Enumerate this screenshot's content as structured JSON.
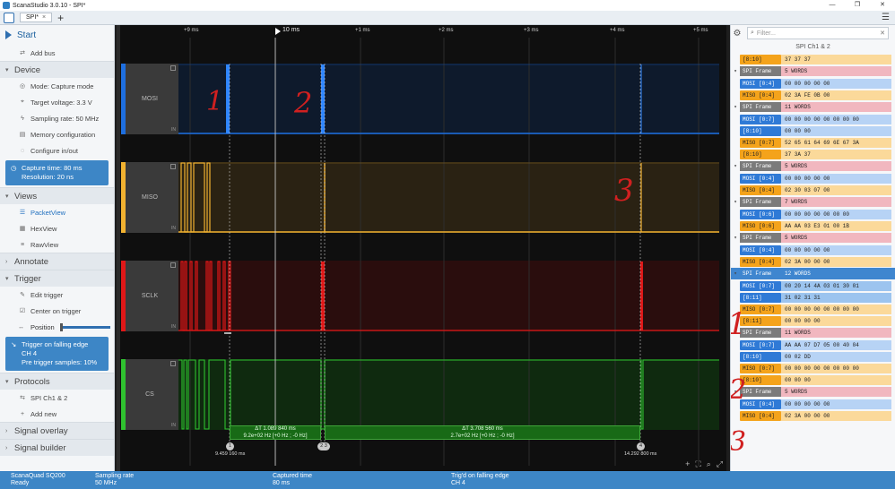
{
  "window": {
    "title": "ScanaStudio 3.0.10 - SPI*",
    "buttons": [
      "—",
      "❐",
      "✕"
    ]
  },
  "tabs": [
    {
      "label": "SPI*"
    }
  ],
  "sidebar": {
    "start": "Start",
    "add_bus": "Add bus",
    "device": {
      "title": "Device",
      "items": [
        "Mode: Capture mode",
        "Target voltage: 3.3 V",
        "Sampling rate: 50 MHz",
        "Memory configuration",
        "Configure in/out"
      ],
      "capture_box": [
        "Capture time: 80 ms",
        "Resolution: 20 ns"
      ]
    },
    "views": {
      "title": "Views",
      "items": [
        "PacketView",
        "HexView",
        "RawView"
      ]
    },
    "annotate": "Annotate",
    "trigger": {
      "title": "Trigger",
      "items": [
        "Edit trigger",
        "Center on trigger",
        "Position"
      ],
      "box": [
        "Trigger on falling edge",
        "CH 4",
        "Pre trigger samples: 10%"
      ]
    },
    "protocols": {
      "title": "Protocols",
      "items": [
        "SPI Ch1 & 2",
        "Add new"
      ]
    },
    "signal_overlay": "Signal overlay",
    "signal_builder": "Signal builder"
  },
  "waveform": {
    "cursor_label": "10 ms",
    "time_labels": [
      "+9 ms",
      "+1 ms",
      "+2 ms",
      "+3 ms",
      "+4 ms",
      "+5 ms"
    ],
    "channels": [
      {
        "name": "MOSI",
        "color": "#1e6fe0"
      },
      {
        "name": "MISO",
        "color": "#f2b230"
      },
      {
        "name": "SCLK",
        "color": "#e01818"
      },
      {
        "name": "CS",
        "color": "#2fc22f"
      }
    ],
    "measure1": {
      "delta": "ΔT 1.089 840 ms",
      "freq": "9.2e+02 Hz [+0 Hz ; -0 Hz]"
    },
    "measure2": {
      "delta": "ΔT 3.708 560 ms",
      "freq": "2.7e+02 Hz [+0 Hz ; -0 Hz]"
    },
    "markers": [
      "1",
      "2 3",
      "4"
    ],
    "marker_times": [
      "9.459 160 ms",
      "14.292 800 ms"
    ],
    "annotations": [
      "1",
      "2",
      "3"
    ],
    "bottom_icons": [
      "+",
      "⛶",
      "⌕",
      "⤢"
    ]
  },
  "packets": {
    "filter_placeholder": "Filter...",
    "header": "SPI Ch1 & 2",
    "first_row": {
      "name": "[8:10]",
      "value": "37 37 37"
    },
    "frames": [
      {
        "name": "SPI Frame",
        "words": "5 WORDS",
        "rows": [
          {
            "type": "mosi",
            "name": "MOSI [0:4]",
            "value": "00 00 00 00 00"
          },
          {
            "type": "miso",
            "name": "MISO [0:4]",
            "value": "02 3A FE 0B 00"
          }
        ]
      },
      {
        "name": "SPI Frame",
        "words": "11 WORDS",
        "rows": [
          {
            "type": "mosi",
            "name": "MOSI [0:7]",
            "value": "00 00 00 00 00 00 00 00"
          },
          {
            "type": "mosi",
            "name": "[8:10]",
            "value": "00 00 00"
          },
          {
            "type": "miso",
            "name": "MISO [0:7]",
            "value": "52 65 61 64 69 6E 67 3A"
          },
          {
            "type": "miso",
            "name": "[8:10]",
            "value": "37 3A 37"
          }
        ]
      },
      {
        "name": "SPI Frame",
        "words": "5 WORDS",
        "rows": [
          {
            "type": "mosi",
            "name": "MOSI [0:4]",
            "value": "00 00 00 00 00"
          },
          {
            "type": "miso",
            "name": "MISO [0:4]",
            "value": "02 30 03 07 00"
          }
        ]
      },
      {
        "name": "SPI Frame",
        "words": "7 WORDS",
        "rows": [
          {
            "type": "mosi",
            "name": "MOSI [0:6]",
            "value": "00 00 00 00 00 00 00"
          },
          {
            "type": "miso",
            "name": "MISO [0:6]",
            "value": "AA AA 03 E3 01 00 1B"
          }
        ]
      },
      {
        "name": "SPI Frame",
        "words": "5 WORDS",
        "rows": [
          {
            "type": "mosi",
            "name": "MOSI [0:4]",
            "value": "00 00 00 00 00"
          },
          {
            "type": "miso",
            "name": "MISO [0:4]",
            "value": "02 3A 00 00 00"
          }
        ]
      },
      {
        "name": "SPI Frame",
        "words": "12 WORDS",
        "selected": true,
        "rows": [
          {
            "type": "mosi",
            "name": "MOSI [0:7]",
            "value": "00 20 14 4A 03 01 30 01"
          },
          {
            "type": "mosi",
            "name": "[8:11]",
            "value": "31 02 31 31"
          },
          {
            "type": "miso",
            "name": "MISO [0:7]",
            "value": "00 00 00 00 00 00 00 00"
          },
          {
            "type": "miso",
            "name": "[8:11]",
            "value": "00 00 00 00"
          }
        ]
      },
      {
        "name": "SPI Frame",
        "words": "11 WORDS",
        "rows": [
          {
            "type": "mosi",
            "name": "MOSI [0:7]",
            "value": "AA AA 07 D7 05 00 40 04"
          },
          {
            "type": "mosi",
            "name": "[8:10]",
            "value": "00 02 DD"
          },
          {
            "type": "miso",
            "name": "MISO [0:7]",
            "value": "00 00 00 00 00 00 00 00"
          },
          {
            "type": "miso",
            "name": "[8:10]",
            "value": "00 00 00"
          }
        ]
      },
      {
        "name": "SPI Frame",
        "words": "5 WORDS",
        "rows": [
          {
            "type": "mosi",
            "name": "MOSI [0:4]",
            "value": "00 00 00 00 00"
          },
          {
            "type": "miso",
            "name": "MISO [0:4]",
            "value": "02 3A 00 00 00"
          }
        ]
      }
    ],
    "annotations": [
      "1",
      "2",
      "3"
    ]
  },
  "status": [
    {
      "label": "ScanaQuad SQ200",
      "value": "Ready"
    },
    {
      "label": "Sampling rate",
      "value": "50 MHz"
    },
    {
      "label": "Captured time",
      "value": "80 ms"
    },
    {
      "label": "Trig'd on falling edge",
      "value": "CH 4"
    }
  ]
}
